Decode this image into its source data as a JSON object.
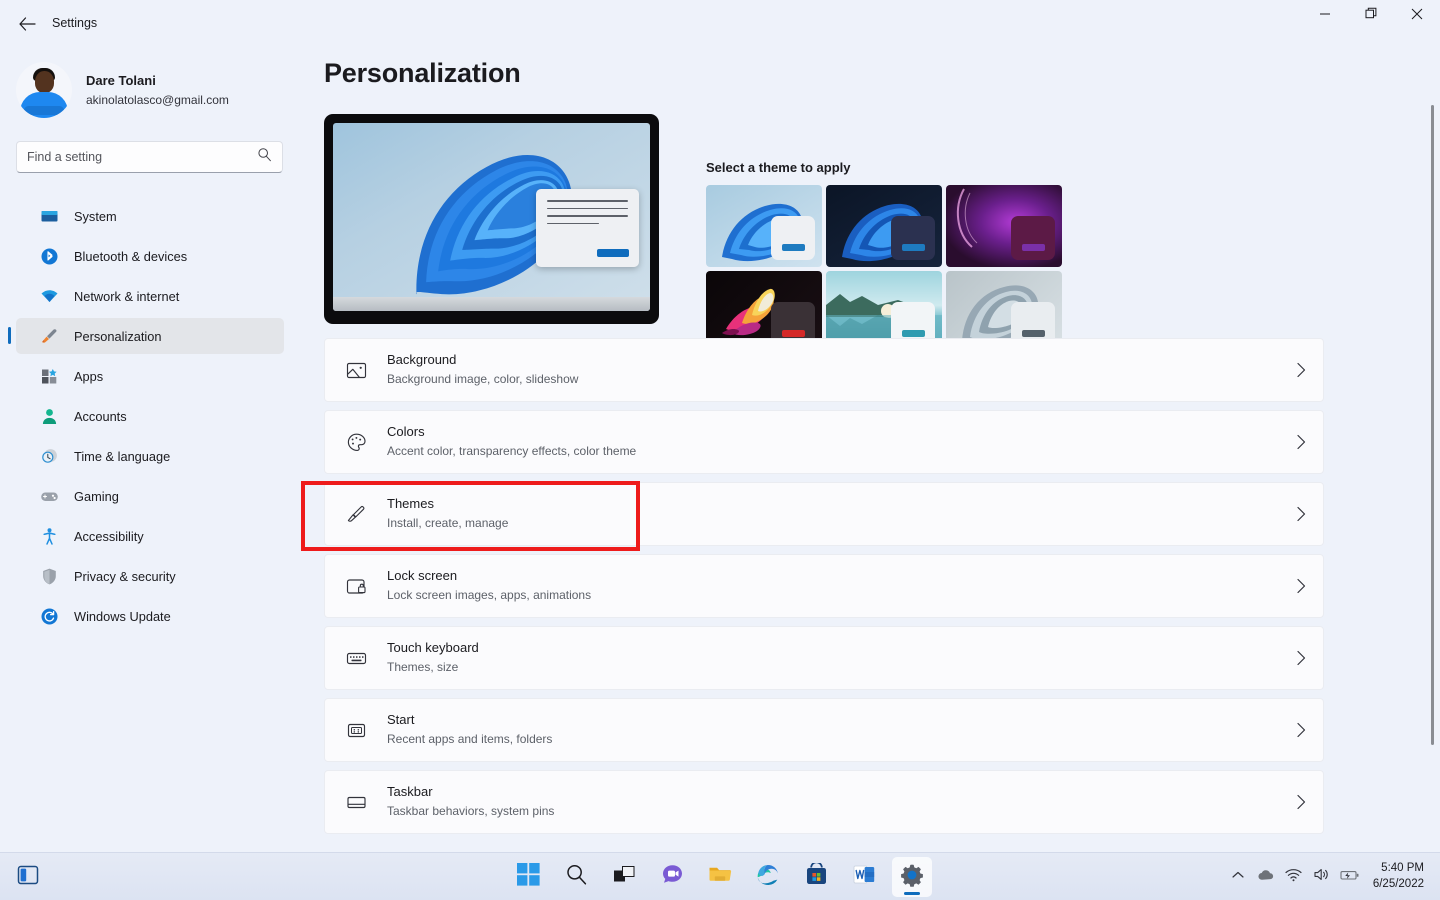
{
  "window": {
    "title": "Settings",
    "back_icon": "back-arrow-icon",
    "controls": {
      "minimize": "minimize-icon",
      "restore": "restore-icon",
      "close": "close-icon"
    }
  },
  "sidebar": {
    "profile": {
      "name": "Dare Tolani",
      "email": "akinolatolasco@gmail.com"
    },
    "search": {
      "placeholder": "Find a setting",
      "value": "",
      "icon": "search-icon"
    },
    "items": [
      {
        "label": "System",
        "icon": "monitor-icon",
        "active": false
      },
      {
        "label": "Bluetooth & devices",
        "icon": "bluetooth-icon",
        "active": false
      },
      {
        "label": "Network & internet",
        "icon": "wifi-icon",
        "active": false
      },
      {
        "label": "Personalization",
        "icon": "paintbrush-icon",
        "active": true
      },
      {
        "label": "Apps",
        "icon": "apps-grid-icon",
        "active": false
      },
      {
        "label": "Accounts",
        "icon": "person-icon",
        "active": false
      },
      {
        "label": "Time & language",
        "icon": "clock-icon",
        "active": false
      },
      {
        "label": "Gaming",
        "icon": "gamepad-icon",
        "active": false
      },
      {
        "label": "Accessibility",
        "icon": "accessibility-icon",
        "active": false
      },
      {
        "label": "Privacy & security",
        "icon": "shield-icon",
        "active": false
      },
      {
        "label": "Windows Update",
        "icon": "update-refresh-icon",
        "active": false
      }
    ]
  },
  "main": {
    "page_title": "Personalization",
    "preview": {
      "label": "desktop-preview",
      "accent_color": "#0f6cbd"
    },
    "themes": {
      "heading": "Select a theme to apply",
      "items": [
        {
          "name": "windows-light-bloom",
          "accent": "#1e7bc0",
          "window_bg": "#eef0f3",
          "bg_from": "#a8cbe0",
          "bg_to": "#cfe2ef"
        },
        {
          "name": "windows-dark-bloom",
          "accent": "#1e7bc0",
          "window_bg": "#2b3150",
          "bg_from": "#0b1526",
          "bg_to": "#16243c"
        },
        {
          "name": "glow-purple",
          "accent": "#7a30a8",
          "window_bg": "#5c1a46",
          "bg_from": "#2a0d2e",
          "bg_to": "#8a1f6e"
        },
        {
          "name": "flow-flower-dark",
          "accent": "#d42828",
          "window_bg": "#3a3136",
          "bg_from": "#0a0608",
          "bg_to": "#1a0f14"
        },
        {
          "name": "captured-motion-lake",
          "accent": "#2f9bb0",
          "window_bg": "#f2f5f7",
          "bg_from": "#9ed4de",
          "bg_to": "#dff0f3"
        },
        {
          "name": "sunrise-feathers",
          "accent": "#54616b",
          "window_bg": "#e9edf0",
          "bg_from": "#b9c4c9",
          "bg_to": "#d9e1e5"
        }
      ]
    },
    "rows": [
      {
        "title": "Background",
        "subtitle": "Background image, color, slideshow",
        "icon": "picture-icon",
        "chevron": "chevron-right-icon",
        "highlighted": false
      },
      {
        "title": "Colors",
        "subtitle": "Accent color, transparency effects, color theme",
        "icon": "palette-icon",
        "chevron": "chevron-right-icon",
        "highlighted": true
      },
      {
        "title": "Themes",
        "subtitle": "Install, create, manage",
        "icon": "paintbrush-icon",
        "chevron": "chevron-right-icon",
        "highlighted": false
      },
      {
        "title": "Lock screen",
        "subtitle": "Lock screen images, apps, animations",
        "icon": "lock-screen-icon",
        "chevron": "chevron-right-icon",
        "highlighted": false
      },
      {
        "title": "Touch keyboard",
        "subtitle": "Themes, size",
        "icon": "keyboard-icon",
        "chevron": "chevron-right-icon",
        "highlighted": false
      },
      {
        "title": "Start",
        "subtitle": "Recent apps and items, folders",
        "icon": "start-menu-icon",
        "chevron": "chevron-right-icon",
        "highlighted": false
      },
      {
        "title": "Taskbar",
        "subtitle": "Taskbar behaviors, system pins",
        "icon": "taskbar-icon",
        "chevron": "chevron-right-icon",
        "highlighted": false
      }
    ],
    "highlight_color": "#ee1b1b"
  },
  "taskbar": {
    "widgets_icon": "widgets-icon",
    "apps": [
      {
        "name": "start-button",
        "icon": "windows-logo-icon",
        "active": false
      },
      {
        "name": "search-button",
        "icon": "search-icon",
        "active": false
      },
      {
        "name": "task-view-button",
        "icon": "task-view-icon",
        "active": false
      },
      {
        "name": "chat-button",
        "icon": "chat-video-icon",
        "active": false
      },
      {
        "name": "file-explorer-button",
        "icon": "folder-icon",
        "active": false
      },
      {
        "name": "edge-button",
        "icon": "edge-icon",
        "active": false
      },
      {
        "name": "microsoft-store-button",
        "icon": "store-bag-icon",
        "active": false
      },
      {
        "name": "word-button",
        "icon": "word-icon",
        "active": false
      },
      {
        "name": "settings-button",
        "icon": "gear-icon",
        "active": true
      }
    ],
    "tray": [
      {
        "name": "show-hidden-icons",
        "icon": "chevron-up-icon"
      },
      {
        "name": "onedrive",
        "icon": "cloud-icon"
      },
      {
        "name": "network",
        "icon": "wifi-icon"
      },
      {
        "name": "volume",
        "icon": "speaker-icon"
      },
      {
        "name": "battery",
        "icon": "battery-charging-icon"
      }
    ],
    "clock": {
      "time": "5:40 PM",
      "date": "6/25/2022"
    }
  }
}
